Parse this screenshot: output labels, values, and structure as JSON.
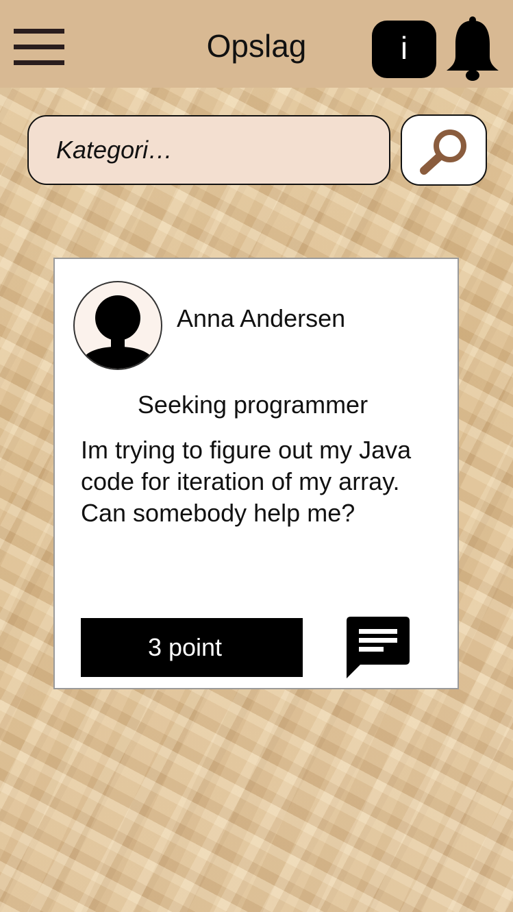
{
  "header": {
    "title": "Opslag",
    "info_label": "i",
    "icons": {
      "menu": "hamburger-menu-icon",
      "notifications": "bell-icon"
    }
  },
  "search": {
    "placeholder": "Kategori…",
    "button_icon": "magnifier-icon"
  },
  "post": {
    "author": "Anna Andersen",
    "avatar_icon": "user-silhouette-icon",
    "title": "Seeking programmer",
    "body": "Im trying to figure out my Java code for iteration of my array. Can somebody help me?",
    "points": "3 point",
    "comment_icon": "comment-icon"
  },
  "colors": {
    "header_bg": "#d8b993",
    "search_field_bg": "#f3dfd0",
    "magnifier": "#8a5c3d",
    "card_bg": "#ffffff",
    "badge_bg": "#000000"
  }
}
